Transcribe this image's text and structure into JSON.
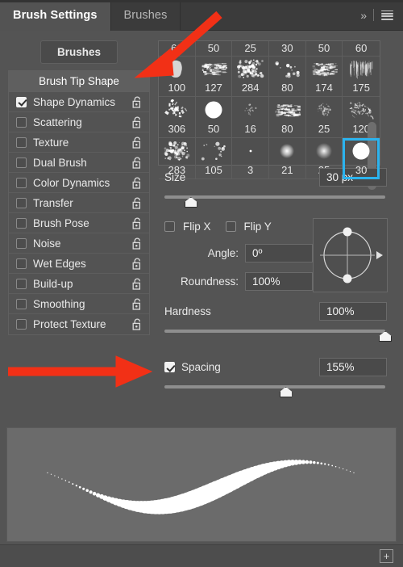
{
  "window": {
    "title": "Brush Settings"
  },
  "tabs": [
    {
      "label": "Brush Settings",
      "active": true
    },
    {
      "label": "Brushes",
      "active": false
    }
  ],
  "header_tools": {
    "collapse_label": "»",
    "collapse_icon": "chevron-double-right-icon",
    "menu_icon": "hamburger-menu-icon"
  },
  "sidebar": {
    "brushes_button": "Brushes",
    "heading": "Brush Tip Shape",
    "items": [
      {
        "label": "Shape Dynamics",
        "checked": true,
        "locked": false
      },
      {
        "label": "Scattering",
        "checked": false,
        "locked": false
      },
      {
        "label": "Texture",
        "checked": false,
        "locked": false
      },
      {
        "label": "Dual Brush",
        "checked": false,
        "locked": false
      },
      {
        "label": "Color Dynamics",
        "checked": false,
        "locked": false
      },
      {
        "label": "Transfer",
        "checked": false,
        "locked": false
      },
      {
        "label": "Brush Pose",
        "checked": false,
        "locked": false
      },
      {
        "label": "Noise",
        "checked": false,
        "locked": false
      },
      {
        "label": "Wet Edges",
        "checked": false,
        "locked": false
      },
      {
        "label": "Build-up",
        "checked": false,
        "locked": false
      },
      {
        "label": "Smoothing",
        "checked": false,
        "locked": false
      },
      {
        "label": "Protect Texture",
        "checked": false,
        "locked": false
      }
    ]
  },
  "brush_grid": {
    "partial_top_row_sizes": [
      "60",
      "50",
      "25",
      "30",
      "50",
      "60"
    ],
    "rows": [
      [
        {
          "size": "100",
          "style": "blob",
          "selected": false
        },
        {
          "size": "127",
          "style": "smear",
          "selected": false
        },
        {
          "size": "284",
          "style": "spatter",
          "selected": false
        },
        {
          "size": "80",
          "style": "sparse",
          "selected": false
        },
        {
          "size": "174",
          "style": "drybrush",
          "selected": false
        },
        {
          "size": "175",
          "style": "bristle",
          "selected": false
        }
      ],
      [
        {
          "size": "306",
          "style": "burst",
          "selected": false
        },
        {
          "size": "50",
          "style": "hardround",
          "selected": false
        },
        {
          "size": "16",
          "style": "faintstar",
          "selected": false
        },
        {
          "size": "80",
          "style": "chalk",
          "selected": false
        },
        {
          "size": "25",
          "style": "fuzzball",
          "selected": false
        },
        {
          "size": "120",
          "style": "scribble",
          "selected": false
        }
      ],
      [
        {
          "size": "283",
          "style": "spatter2",
          "selected": false
        },
        {
          "size": "105",
          "style": "sparse2",
          "selected": false
        },
        {
          "size": "3",
          "style": "tinydot",
          "selected": false
        },
        {
          "size": "21",
          "style": "softround",
          "selected": false
        },
        {
          "size": "25",
          "style": "softround2",
          "selected": false
        },
        {
          "size": "30",
          "style": "hardround",
          "selected": true
        }
      ]
    ],
    "selected_size": "30",
    "selection_color": "#2bb3ee"
  },
  "controls": {
    "size": {
      "label": "Size",
      "value": "30 px",
      "slider_percent": 12
    },
    "flip_x": {
      "label": "Flip X",
      "checked": false
    },
    "flip_y": {
      "label": "Flip Y",
      "checked": false
    },
    "angle": {
      "label": "Angle:",
      "value": "0º"
    },
    "roundness": {
      "label": "Roundness:",
      "value": "100%"
    },
    "hardness": {
      "label": "Hardness",
      "value": "100%",
      "slider_percent": 100
    },
    "spacing": {
      "label": "Spacing",
      "value": "155%",
      "checked": true,
      "slider_percent": 55
    },
    "angle_control": {
      "name": "angle-dial",
      "handle_top": true,
      "handle_bottom": true,
      "pointer": "right"
    }
  },
  "preview": {
    "name": "brush-stroke-preview",
    "description": "tapered sine-wave stroke of round dots"
  },
  "footer": {
    "new_brush_icon": "plus-icon",
    "new_brush_label": "+"
  },
  "annotations": [
    {
      "name": "arrow-to-brush-tip-shape",
      "color": "#f23016",
      "direction": "down-left"
    },
    {
      "name": "arrow-to-spacing",
      "color": "#f23016",
      "direction": "right"
    }
  ]
}
